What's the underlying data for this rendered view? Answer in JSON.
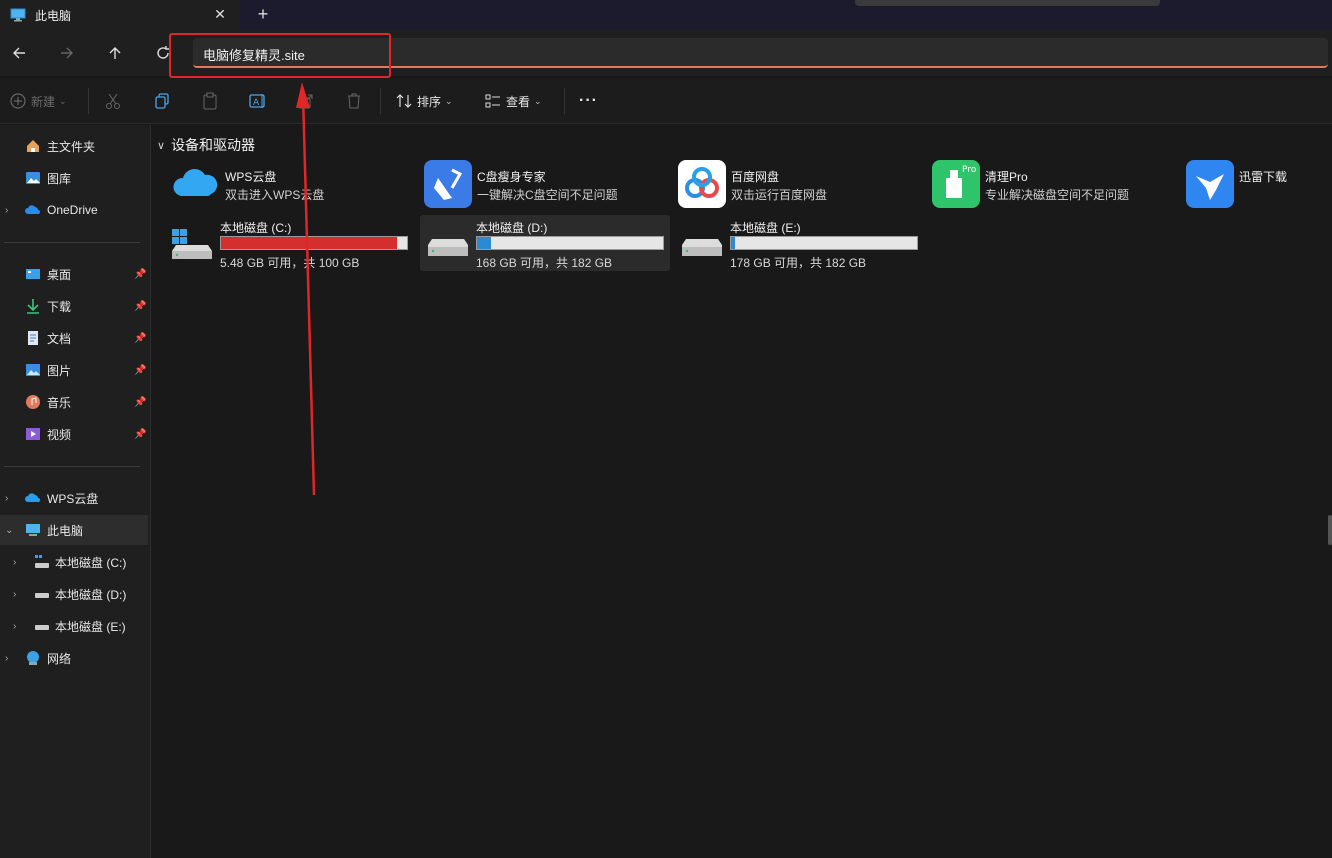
{
  "window": {
    "tab_title": "此电脑",
    "address": "电脑修复精灵.site"
  },
  "toolbar": {
    "new_label": "新建",
    "sort_label": "排序",
    "view_label": "查看"
  },
  "sidebar": {
    "home": "主文件夹",
    "gallery": "图库",
    "onedrive": "OneDrive",
    "pinned": [
      {
        "label": "桌面",
        "icon": "desktop-icon"
      },
      {
        "label": "下载",
        "icon": "download-icon"
      },
      {
        "label": "文档",
        "icon": "document-icon"
      },
      {
        "label": "图片",
        "icon": "pictures-icon"
      },
      {
        "label": "音乐",
        "icon": "music-icon"
      },
      {
        "label": "视频",
        "icon": "video-icon"
      }
    ],
    "wps": "WPS云盘",
    "thispc": "此电脑",
    "drives": [
      "本地磁盘 (C:)",
      "本地磁盘 (D:)",
      "本地磁盘 (E:)"
    ],
    "network": "网络"
  },
  "main": {
    "section_title": "设备和驱动器",
    "apps": [
      {
        "name": "WPS云盘",
        "desc": "双击进入WPS云盘",
        "icon": "wps-cloud-icon"
      },
      {
        "name": "C盘瘦身专家",
        "desc": "一键解决C盘空间不足问题",
        "icon": "broom-icon"
      },
      {
        "name": "百度网盘",
        "desc": "双击运行百度网盘",
        "icon": "baidu-netdisk-icon"
      },
      {
        "name": "清理Pro",
        "desc": "专业解决磁盘空间不足问题",
        "icon": "cleaner-pro-icon"
      },
      {
        "name": "迅雷下载",
        "desc": "",
        "icon": "thunder-icon"
      }
    ],
    "drives": [
      {
        "name": "本地磁盘 (C:)",
        "free": "5.48 GB 可用，共 100 GB",
        "used_fraction": 0.945,
        "bar_color": "#d42e2e"
      },
      {
        "name": "本地磁盘 (D:)",
        "free": "168 GB 可用，共 182 GB",
        "used_fraction": 0.077,
        "bar_color": "#2a8ad4"
      },
      {
        "name": "本地磁盘 (E:)",
        "free": "178 GB 可用，共 182 GB",
        "used_fraction": 0.022,
        "bar_color": "#2a8ad4"
      }
    ]
  }
}
